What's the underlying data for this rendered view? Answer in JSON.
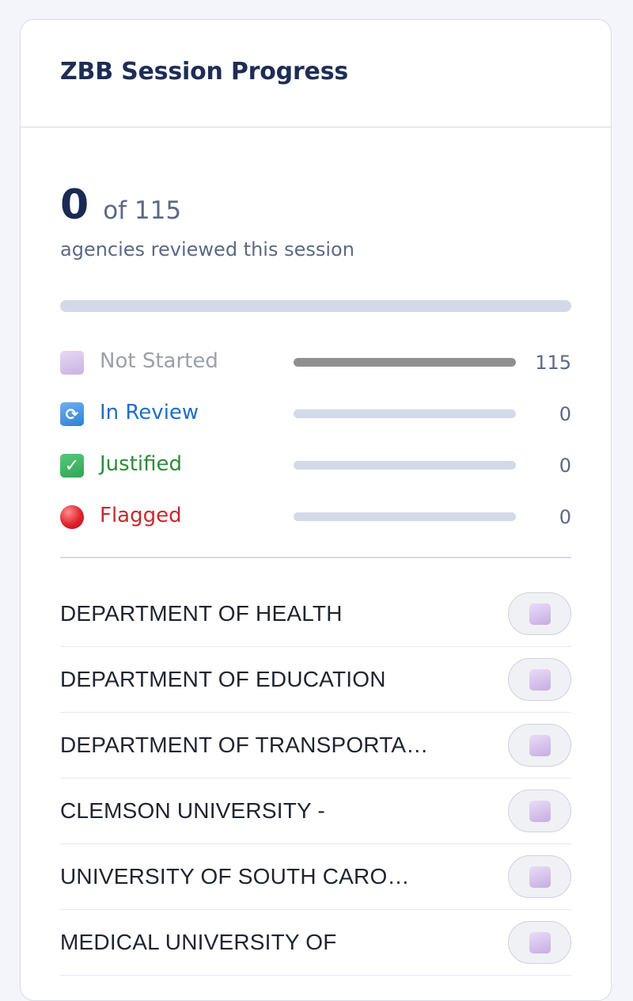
{
  "header": {
    "title": "ZBB Session Progress"
  },
  "summary": {
    "reviewed_count": "0",
    "total_text": "of 115",
    "subtitle": "agencies reviewed this session",
    "progress_fraction": 0
  },
  "statuses": [
    {
      "label": "Not Started",
      "count": "115",
      "value": 115,
      "color": "#9aa0ab",
      "bar_color": "#8f8f8f",
      "icon": "not-started-square-icon"
    },
    {
      "label": "In Review",
      "count": "0",
      "value": 0,
      "color": "#1f6fc5",
      "bar_color": "#2f7fd6",
      "icon": "refresh-icon",
      "glyph": "⟳"
    },
    {
      "label": "Justified",
      "count": "0",
      "value": 0,
      "color": "#2e8b3a",
      "bar_color": "#2fa556",
      "icon": "check-icon",
      "glyph": "✓"
    },
    {
      "label": "Flagged",
      "count": "0",
      "value": 0,
      "color": "#c8272f",
      "bar_color": "#e0212c",
      "icon": "red-circle-icon"
    }
  ],
  "total": 115,
  "agencies": [
    {
      "name": "DEPARTMENT OF HEALTH",
      "status": "Not Started"
    },
    {
      "name": "DEPARTMENT OF EDUCATION",
      "status": "Not Started"
    },
    {
      "name": "DEPARTMENT OF TRANSPORTA…",
      "status": "Not Started"
    },
    {
      "name": "CLEMSON UNIVERSITY -",
      "status": "Not Started"
    },
    {
      "name": "UNIVERSITY OF SOUTH CARO…",
      "status": "Not Started"
    },
    {
      "name": "MEDICAL UNIVERSITY OF",
      "status": "Not Started"
    }
  ]
}
